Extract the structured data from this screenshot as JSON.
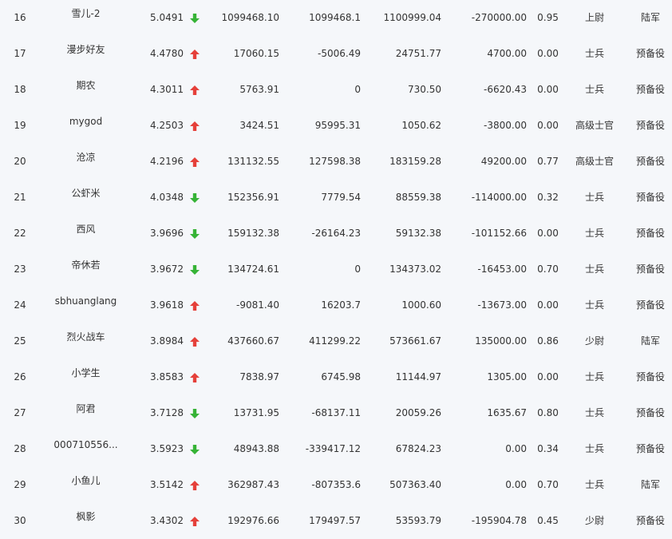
{
  "colors": {
    "up": "#e5403a",
    "down": "#36b336"
  },
  "rows": [
    {
      "rank": "16",
      "name": "雪儿-2",
      "score": "5.0491",
      "trend": "down",
      "c1": "1099468.10",
      "c2": "1099468.1",
      "c3": "1100999.04",
      "c4": "-270000.00",
      "ratio": "0.95",
      "title": "上尉",
      "status": "陆军"
    },
    {
      "rank": "17",
      "name": "漫步好友",
      "score": "4.4780",
      "trend": "up",
      "c1": "17060.15",
      "c2": "-5006.49",
      "c3": "24751.77",
      "c4": "4700.00",
      "ratio": "0.00",
      "title": "士兵",
      "status": "预备役"
    },
    {
      "rank": "18",
      "name": "期农",
      "score": "4.3011",
      "trend": "up",
      "c1": "5763.91",
      "c2": "0",
      "c3": "730.50",
      "c4": "-6620.43",
      "ratio": "0.00",
      "title": "士兵",
      "status": "预备役"
    },
    {
      "rank": "19",
      "name": "mygod",
      "score": "4.2503",
      "trend": "up",
      "c1": "3424.51",
      "c2": "95995.31",
      "c3": "1050.62",
      "c4": "-3800.00",
      "ratio": "0.00",
      "title": "高级士官",
      "status": "预备役"
    },
    {
      "rank": "20",
      "name": "沧凉",
      "score": "4.2196",
      "trend": "up",
      "c1": "131132.55",
      "c2": "127598.38",
      "c3": "183159.28",
      "c4": "49200.00",
      "ratio": "0.77",
      "title": "高级士官",
      "status": "预备役"
    },
    {
      "rank": "21",
      "name": "公虾米",
      "score": "4.0348",
      "trend": "down",
      "c1": "152356.91",
      "c2": "7779.54",
      "c3": "88559.38",
      "c4": "-114000.00",
      "ratio": "0.32",
      "title": "士兵",
      "status": "预备役"
    },
    {
      "rank": "22",
      "name": "西风",
      "score": "3.9696",
      "trend": "down",
      "c1": "159132.38",
      "c2": "-26164.23",
      "c3": "59132.38",
      "c4": "-101152.66",
      "ratio": "0.00",
      "title": "士兵",
      "status": "预备役"
    },
    {
      "rank": "23",
      "name": "帝休若",
      "score": "3.9672",
      "trend": "down",
      "c1": "134724.61",
      "c2": "0",
      "c3": "134373.02",
      "c4": "-16453.00",
      "ratio": "0.70",
      "title": "士兵",
      "status": "预备役"
    },
    {
      "rank": "24",
      "name": "sbhuanglang",
      "score": "3.9618",
      "trend": "up",
      "c1": "-9081.40",
      "c2": "16203.7",
      "c3": "1000.60",
      "c4": "-13673.00",
      "ratio": "0.00",
      "title": "士兵",
      "status": "预备役"
    },
    {
      "rank": "25",
      "name": "烈火战车",
      "score": "3.8984",
      "trend": "up",
      "c1": "437660.67",
      "c2": "411299.22",
      "c3": "573661.67",
      "c4": "135000.00",
      "ratio": "0.86",
      "title": "少尉",
      "status": "陆军"
    },
    {
      "rank": "26",
      "name": "小学生",
      "score": "3.8583",
      "trend": "up",
      "c1": "7838.97",
      "c2": "6745.98",
      "c3": "11144.97",
      "c4": "1305.00",
      "ratio": "0.00",
      "title": "士兵",
      "status": "预备役"
    },
    {
      "rank": "27",
      "name": "阿君",
      "score": "3.7128",
      "trend": "down",
      "c1": "13731.95",
      "c2": "-68137.11",
      "c3": "20059.26",
      "c4": "1635.67",
      "ratio": "0.80",
      "title": "士兵",
      "status": "预备役"
    },
    {
      "rank": "28",
      "name": "000710556...",
      "score": "3.5923",
      "trend": "down",
      "c1": "48943.88",
      "c2": "-339417.12",
      "c3": "67824.23",
      "c4": "0.00",
      "ratio": "0.34",
      "title": "士兵",
      "status": "预备役"
    },
    {
      "rank": "29",
      "name": "小鱼儿",
      "score": "3.5142",
      "trend": "up",
      "c1": "362987.43",
      "c2": "-807353.6",
      "c3": "507363.40",
      "c4": "0.00",
      "ratio": "0.70",
      "title": "士兵",
      "status": "陆军"
    },
    {
      "rank": "30",
      "name": "枫影",
      "score": "3.4302",
      "trend": "up",
      "c1": "192976.66",
      "c2": "179497.57",
      "c3": "53593.79",
      "c4": "-195904.78",
      "ratio": "0.45",
      "title": "少尉",
      "status": "预备役"
    }
  ]
}
